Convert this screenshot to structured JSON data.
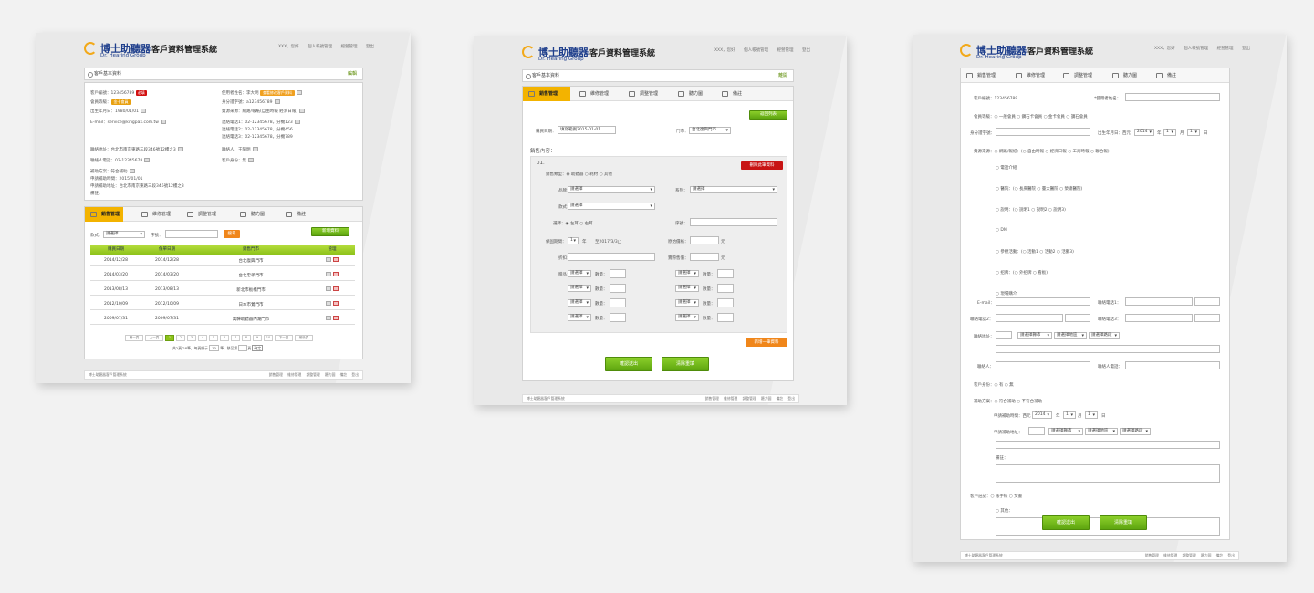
{
  "header": {
    "brand": "博士助聽器",
    "brand_en": "Dr. Hearing Group",
    "system_title": "客戶資料管理系統",
    "links": [
      "XXX，您好",
      "個人帳號管理",
      "經營管理",
      "登出"
    ]
  },
  "panel1": {
    "crumb": "客戶基本資料",
    "crumb_action": "編輯",
    "fields_left": [
      "客戶編號：123456789",
      "會員等級：",
      "出生年月日：1980/01/01",
      "E-mail：service@kingpax.com.tw",
      "聯絡地址：台北市南京東路三段346號12樓之3",
      "聯絡人電話：02-12345678",
      "補助方案：符合補助",
      "申請補助時間：2015/01/01",
      "申請補助地址：台北市南京東路三段346號12樓之3",
      "備註："
    ],
    "member_level": "金卡會員",
    "tag_required": "必填",
    "fields_right": [
      "使用者姓名：李大明",
      "身分證字號：a123456789",
      "資源來源：網路/報紙(自由時報 經濟日報)",
      "連絡電話1：02-12345678，分機123",
      "連絡電話2：02-12345678，分機456",
      "連絡電話3：02-12345678，分機789",
      "聯絡人：王陽明",
      "客戶身份：無"
    ],
    "orange_btn": "查看修改客戶資料",
    "tabs": [
      "銷售管理",
      "維修管理",
      "調整管理",
      "聽力圖",
      "備註"
    ],
    "filter_label": "款式：",
    "filter_select": "請選擇",
    "serial_label": "序號：",
    "search_btn": "搜尋",
    "add_btn": "新增資料",
    "table_headers": [
      "購買日期",
      "保單日期",
      "銷售門市",
      "管理"
    ],
    "rows": [
      {
        "buy": "2014/12/28",
        "warranty": "2014/12/28",
        "store": "台北復興門市"
      },
      {
        "buy": "2014/03/20",
        "warranty": "2014/03/20",
        "store": "台北忠孝門市"
      },
      {
        "buy": "2013/08/13",
        "warranty": "2013/08/13",
        "store": "新北市板橋門市"
      },
      {
        "buy": "2012/10/09",
        "warranty": "2012/10/09",
        "store": "日本市鶯門市"
      },
      {
        "buy": "2009/07/31",
        "warranty": "2009/07/31",
        "store": "萬驊助聽器內湖門市"
      }
    ],
    "pager": [
      "第一頁",
      "上一頁",
      "1",
      "2",
      "3",
      "4",
      "5",
      "6",
      "7",
      "8",
      "9",
      "10",
      "下一頁",
      "最後頁"
    ],
    "pager_info": "共2頁/28筆，每頁顯示",
    "pager_count": "10",
    "pager_goto": "筆，移至第",
    "pager_page": "頁",
    "pager_ok": "確定"
  },
  "panel2": {
    "crumb": "客戶基本資料",
    "crumb_action": "離開",
    "tabs": [
      "銷售管理",
      "維修管理",
      "調整管理",
      "聽力圖",
      "備註"
    ],
    "back_btn": "返回列表",
    "buy_date": "購買日期：",
    "buy_date_val": "填寫範例2015-01-01",
    "store": "門市：",
    "store_val": "台北復興門市",
    "sales_content": "銷售內容：",
    "item_no": "01.",
    "delete_btn": "刪除此筆資料",
    "sale_type": "銷售類型：◉ 助聽器 ○ 耗材 ○ 其他",
    "brand": "品牌：",
    "brand_val": "請選擇",
    "series": "系列：",
    "series_val": "請選擇",
    "model": "款式：",
    "model_val": "請選擇",
    "ear": "選擇：◉ 左耳 ○ 右耳",
    "serial": "序號：",
    "warranty": "保固期間：",
    "warranty_val": "1",
    "warranty_unit": "年",
    "warranty_until": "至2017/3/3止",
    "orig_price": "原始價格：",
    "price_unit": "元",
    "discount": "折扣：",
    "actual_price": "實際售價：",
    "gift": "贈品：",
    "gift_select": "請選擇",
    "qty": "數量：",
    "add_item_btn": "新增一筆資料",
    "submit_btn": "確認送出",
    "clear_btn": "清除重填"
  },
  "panel3": {
    "tabs": [
      "銷售管理",
      "維修管理",
      "調整管理",
      "聽力圖",
      "備註"
    ],
    "customer_no": "客戶編號：123456789",
    "user_name": "*使用者姓名：",
    "member_level": "會員等級：○ 一般會員 ○ 鑽石卡會員 ○ 金卡會員 ○ 讚石會員",
    "id_no": "身分證字號：",
    "birthday": "出生年月日：西元",
    "birthday_year": "2014",
    "year": "年",
    "month_val": "1",
    "month": "月",
    "day_val": "1",
    "day": "日",
    "source": "資源來源：○ 網路/報紙：(○ 自由時報 ○ 經濟日報 ○ 工商時報 ○ 聯合報)",
    "source_opts": [
      "○ 電話介紹",
      "○ 醫院：(○ 長庚醫院 ○ 臺大醫院 ○ 榮總醫院)",
      "○ 說明：(○ 說明1 ○ 說明2 ○ 說明3)",
      "○ DM",
      "○ 參觀活動：(○ 活動1 ○ 活動2 ○ 活動3)",
      "○ 招牌：(○ 外招牌 ○ 看板)",
      "○ 現場購介"
    ],
    "email": "E-mail：",
    "phone1": "聯絡電話1：",
    "phone2": "聯絡電話2：",
    "phone3": "聯絡電話3：",
    "address": "聯絡地址：",
    "city": "請選擇縣市",
    "district": "請選擇地區",
    "road": "請選擇路段",
    "contact": "聯絡人：",
    "contact_phone": "聯絡人電話：",
    "identity": "客戶身份：○ 有 ○ 無",
    "subsidy": "補助方案：○ 符合補助 ○ 不符合補助",
    "subsidy_time": "申請補助時間：西元",
    "subsidy_addr": "申請補助地址：",
    "note": "備註：",
    "account": "客戶註記：○ 帳手帳 ○ 文書",
    "other": "○ 其他：",
    "submit_btn": "確認送出",
    "clear_btn": "清除重填"
  },
  "footer": {
    "copyright": "博士助聽器客戶管理系統",
    "links": [
      "銷售管理",
      "維修管理",
      "調整管理",
      "聽力圖",
      "備註",
      "登出"
    ]
  }
}
